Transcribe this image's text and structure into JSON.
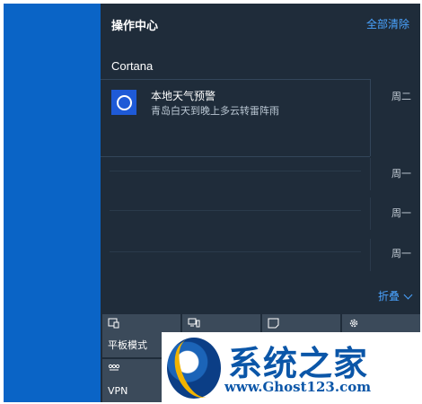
{
  "action_center": {
    "title": "操作中心",
    "clear_all": "全部清除",
    "group": "Cortana",
    "notification": {
      "icon": "cortana-ring-icon",
      "title": "本地天气预警",
      "body": "青岛白天到晚上多云转雷阵雨",
      "day": "周二"
    },
    "older_days": [
      "周一",
      "周一",
      "周一"
    ],
    "collapse_label": "折叠",
    "quick_actions": [
      {
        "label": "平板模式",
        "icon": "tablet-mode-icon"
      },
      {
        "label": "",
        "icon": "connect-icon"
      },
      {
        "label": "",
        "icon": "note-icon"
      },
      {
        "label": "",
        "icon": "settings-gear-icon"
      },
      {
        "label": "VPN",
        "icon": "vpn-icon"
      }
    ]
  },
  "watermark": {
    "name": "系统之家",
    "url": "www.Ghost123.com"
  },
  "colors": {
    "desktop": "#0a64c6",
    "panel": "#1f2c3a",
    "accent": "#4aa3ff",
    "tile": "#3b4a5a",
    "cortana": "#1e5ad7"
  }
}
